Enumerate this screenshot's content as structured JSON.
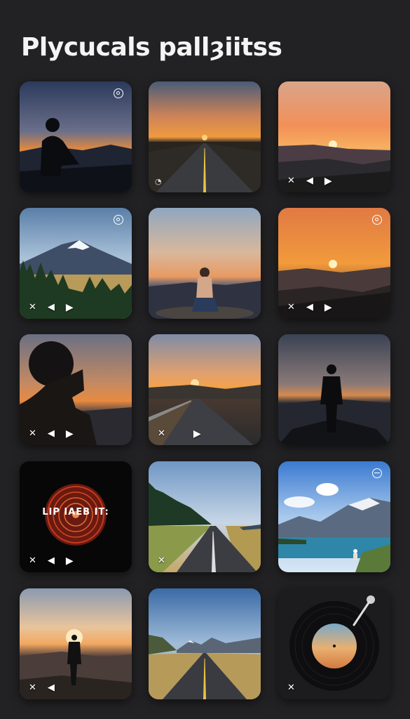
{
  "title": "Plycucals pallȝiitss",
  "controls": {
    "shuffle": "✕",
    "prev": "◀",
    "play": "▶"
  },
  "record_label": "LIP IAEB IT:",
  "icons": {
    "top": "circle-icon",
    "top_minus": "minus-circle-icon",
    "shuffle": "shuffle-icon",
    "prev": "previous-icon",
    "play": "play-icon",
    "nav": "navigation-icon"
  }
}
